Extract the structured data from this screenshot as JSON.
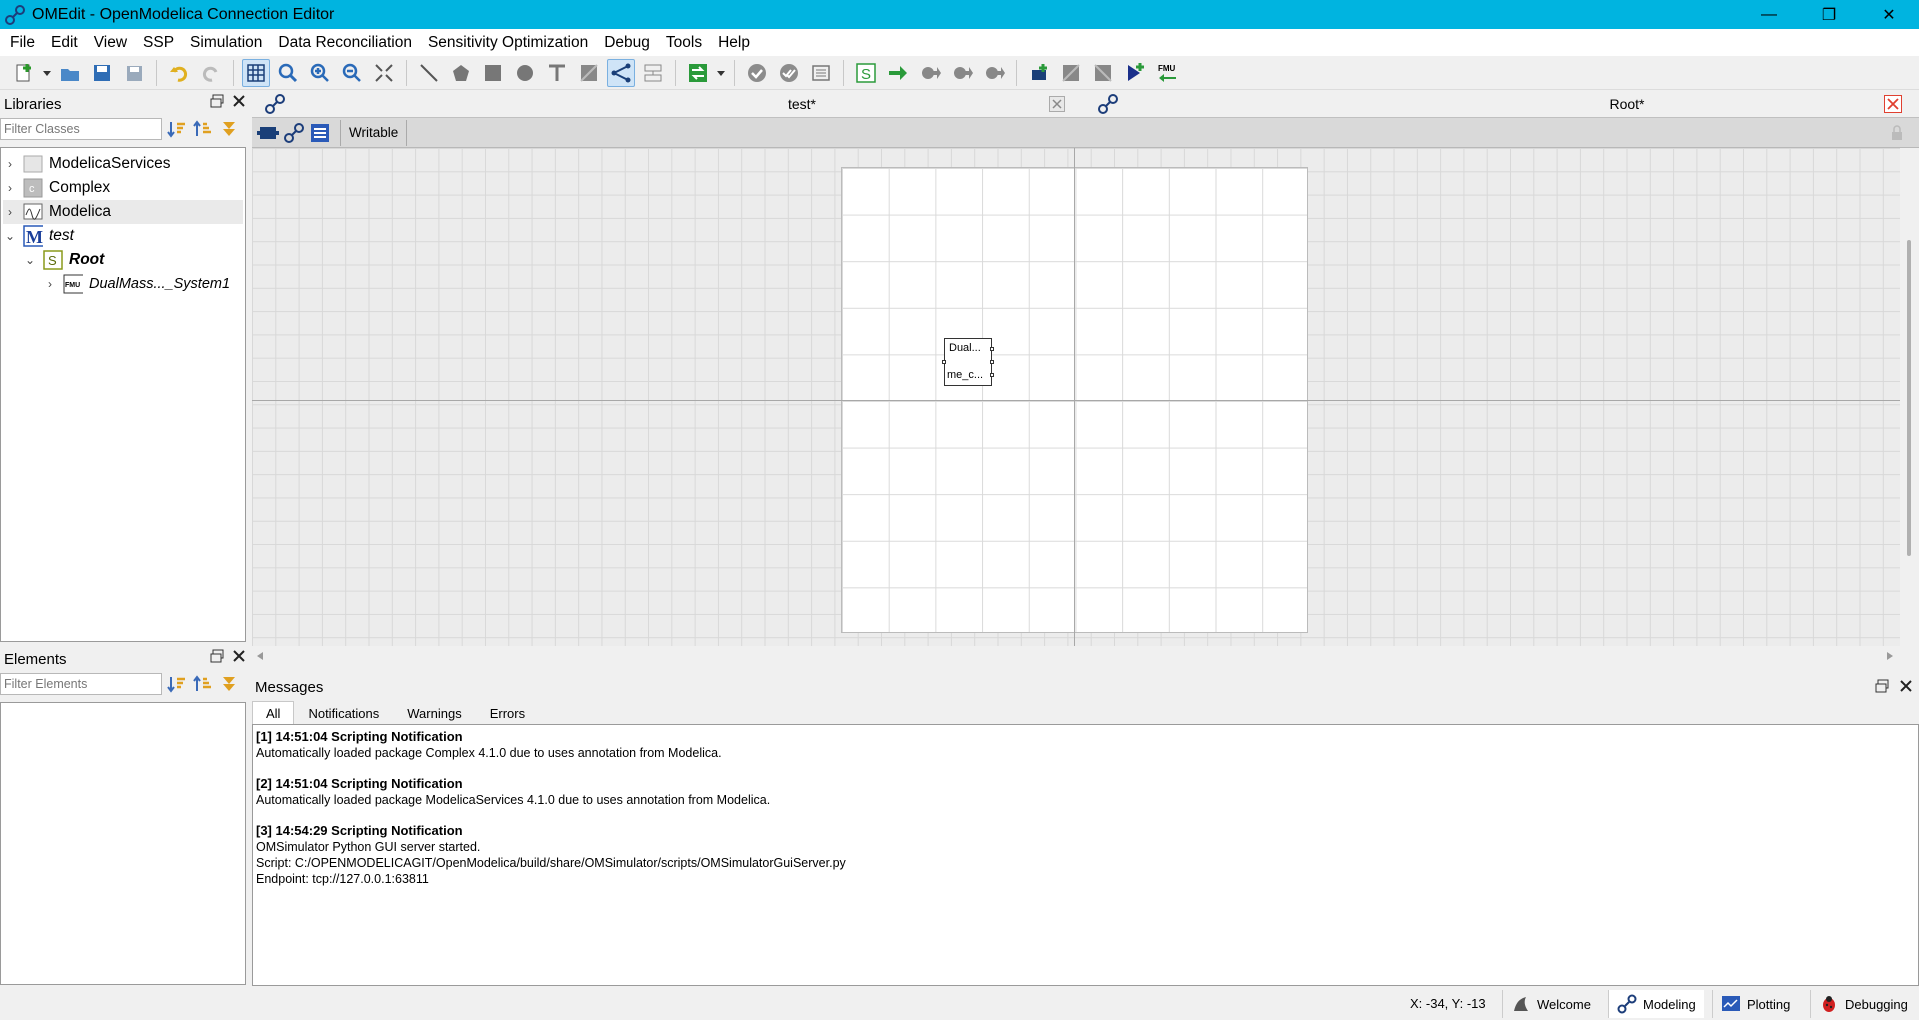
{
  "window": {
    "title": "OMEdit - OpenModelica Connection Editor",
    "accent": "#00b4e0"
  },
  "menu": [
    "File",
    "Edit",
    "View",
    "SSP",
    "Simulation",
    "Data Reconciliation",
    "Sensitivity Optimization",
    "Debug",
    "Tools",
    "Help"
  ],
  "libraries": {
    "title": "Libraries",
    "filter_placeholder": "Filter Classes",
    "tree": [
      {
        "label": "ModelicaServices",
        "icon": "package-icon",
        "expanded": false
      },
      {
        "label": "Complex",
        "icon": "class-c-icon",
        "expanded": false
      },
      {
        "label": "Modelica",
        "icon": "modelica-library-icon",
        "expanded": false
      },
      {
        "label": "test",
        "icon": "model-m-icon",
        "expanded": true
      },
      {
        "label": "Root",
        "icon": "system-s-icon",
        "expanded": true
      },
      {
        "label": "DualMass..._System1",
        "icon": "fmu-icon",
        "expanded": false
      }
    ]
  },
  "elements": {
    "title": "Elements",
    "filter_placeholder": "Filter Elements"
  },
  "tabs": [
    {
      "label": "test*"
    },
    {
      "label": "Root*"
    }
  ],
  "diagram": {
    "writable_label": "Writable",
    "component": {
      "line1": "Dual...",
      "line2": "me_c..."
    }
  },
  "messages": {
    "title": "Messages",
    "tabs": [
      "All",
      "Notifications",
      "Warnings",
      "Errors"
    ],
    "entries": [
      {
        "header": "[1] 14:51:04 Scripting Notification",
        "lines": [
          "Automatically loaded package Complex 4.1.0 due to uses annotation from Modelica."
        ]
      },
      {
        "header": "[2] 14:51:04 Scripting Notification",
        "lines": [
          "Automatically loaded package ModelicaServices 4.1.0 due to uses annotation from Modelica."
        ]
      },
      {
        "header": "[3] 14:54:29 Scripting Notification",
        "lines": [
          "OMSimulator Python GUI server started.",
          "Script: C:/OPENMODELICAGIT/OpenModelica/build/share/OMSimulator/scripts/OMSimulatorGuiServer.py",
          "Endpoint: tcp://127.0.0.1:63811"
        ]
      }
    ]
  },
  "status": {
    "coords": "X: -34, Y: -13",
    "perspectives": [
      "Welcome",
      "Modeling",
      "Plotting",
      "Debugging"
    ],
    "active_perspective": "Modeling"
  }
}
